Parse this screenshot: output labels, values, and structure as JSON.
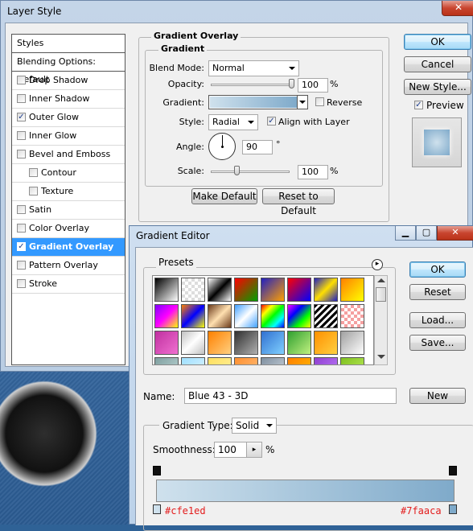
{
  "layer_style": {
    "title": "Layer Style",
    "close_glyph": "✕",
    "styles_header": "Styles",
    "blending_options": "Blending Options: Default",
    "items": [
      {
        "label": "Drop Shadow",
        "checked": false,
        "indent": false
      },
      {
        "label": "Inner Shadow",
        "checked": false,
        "indent": false
      },
      {
        "label": "Outer Glow",
        "checked": true,
        "indent": false
      },
      {
        "label": "Inner Glow",
        "checked": false,
        "indent": false
      },
      {
        "label": "Bevel and Emboss",
        "checked": false,
        "indent": false
      },
      {
        "label": "Contour",
        "checked": false,
        "indent": true
      },
      {
        "label": "Texture",
        "checked": false,
        "indent": true
      },
      {
        "label": "Satin",
        "checked": false,
        "indent": false
      },
      {
        "label": "Color Overlay",
        "checked": false,
        "indent": false
      },
      {
        "label": "Gradient Overlay",
        "checked": true,
        "indent": false,
        "selected": true
      },
      {
        "label": "Pattern Overlay",
        "checked": false,
        "indent": false
      },
      {
        "label": "Stroke",
        "checked": false,
        "indent": false
      }
    ],
    "panel": {
      "group_title": "Gradient Overlay",
      "subgroup_title": "Gradient",
      "blend_mode_label": "Blend Mode:",
      "blend_mode_value": "Normal",
      "opacity_label": "Opacity:",
      "opacity_value": "100",
      "opacity_level_percent": 100,
      "percent": "%",
      "gradient_label": "Gradient:",
      "reverse_label": "Reverse",
      "reverse_checked": false,
      "style_label": "Style:",
      "style_value": "Radial",
      "align_label": "Align with Layer",
      "align_checked": true,
      "angle_label": "Angle:",
      "angle_value": "90",
      "degree": "°",
      "scale_label": "Scale:",
      "scale_value": "100",
      "scale_level_percent": 33,
      "make_default": "Make Default",
      "reset_default": "Reset to Default"
    },
    "buttons": {
      "ok": "OK",
      "cancel": "Cancel",
      "new_style": "New Style...",
      "preview_label": "Preview",
      "preview_checked": true
    }
  },
  "gradient_editor": {
    "title": "Gradient Editor",
    "controls": {
      "minimize": "▁",
      "maximize": "▢",
      "close": "✕"
    },
    "presets_label": "Presets",
    "presets_menu_glyph": "▸",
    "buttons": {
      "ok": "OK",
      "reset": "Reset",
      "load": "Load...",
      "save": "Save...",
      "new": "New"
    },
    "name_label": "Name:",
    "name_value": "Blue 43 - 3D",
    "gradient_type_label": "Gradient Type:",
    "gradient_type_value": "Solid",
    "smoothness_label": "Smoothness:",
    "smoothness_value": "100",
    "smoothness_unit": "%",
    "color_start": "#cfe1ed",
    "color_end": "#7faaca",
    "color_start_label": "#cfe1ed",
    "color_end_label": "#7faaca"
  },
  "colors": {
    "selection_blue": "#3399ff",
    "annotation_red": "#e31c1c"
  }
}
